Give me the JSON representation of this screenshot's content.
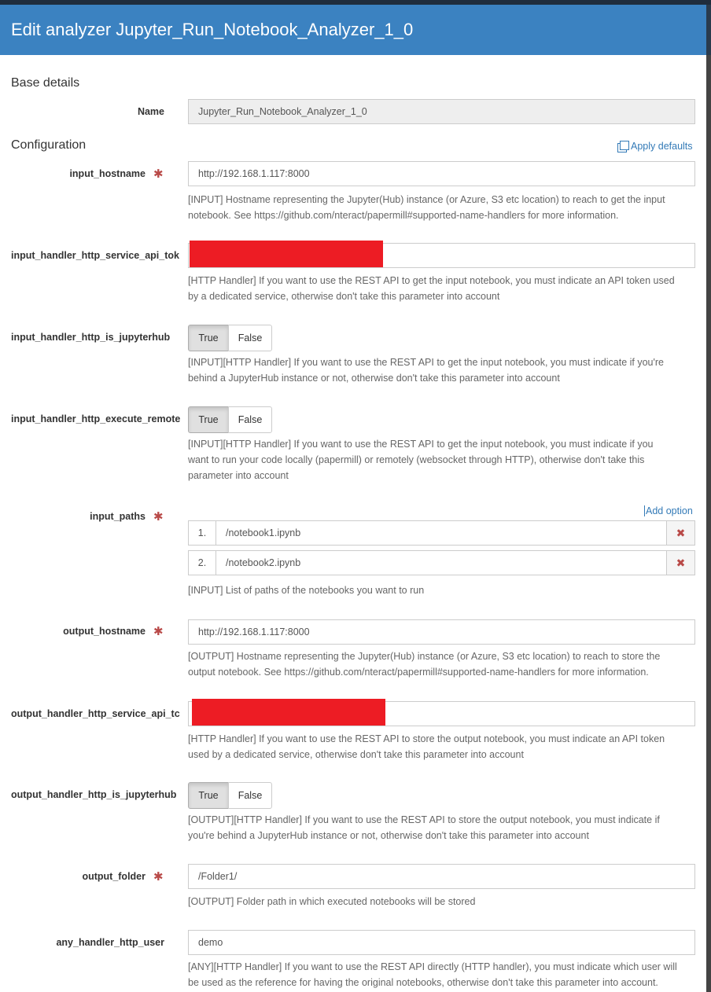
{
  "header": {
    "title": "Edit analyzer Jupyter_Run_Notebook_Analyzer_1_0"
  },
  "base": {
    "section_title": "Base details",
    "name_label": "Name",
    "name_value": "Jupyter_Run_Notebook_Analyzer_1_0"
  },
  "config": {
    "section_title": "Configuration",
    "apply_defaults": "Apply defaults",
    "fields": {
      "input_hostname": {
        "label": "input_hostname",
        "value": "http://192.168.1.117:8000",
        "help1": "[INPUT] Hostname representing the Jupyter(Hub) instance (or Azure, S3 etc location) to reach to get the input",
        "help2": "notebook. See https://github.com/nteract/papermill#supported-name-handlers for more information."
      },
      "input_api_token": {
        "label": "input_handler_http_service_api_tok",
        "help1": "[HTTP Handler] If you want to use the REST API to get the input notebook, you must indicate an API token used",
        "help2": "by a dedicated service, otherwise don't take this parameter into account"
      },
      "input_is_jupyterhub": {
        "label": "input_handler_http_is_jupyterhub",
        "true_label": "True",
        "false_label": "False",
        "help1": "[INPUT][HTTP Handler] If you want to use the REST API to get the input notebook, you must indicate if you're",
        "help2": "behind a JupyterHub instance or not, otherwise don't take this parameter into account"
      },
      "input_execute_remote": {
        "label": "input_handler_http_execute_remote",
        "true_label": "True",
        "false_label": "False",
        "help1": "[INPUT][HTTP Handler] If you want to use the REST API to get the input notebook, you must indicate if you",
        "help2": "want to run your code locally (papermill) or remotely (websocket through HTTP), otherwise don't take this",
        "help3": "parameter into account"
      },
      "input_paths": {
        "label": "input_paths",
        "add_option": "Add option",
        "items": [
          {
            "num": "1.",
            "value": "/notebook1.ipynb"
          },
          {
            "num": "2.",
            "value": "/notebook2.ipynb"
          }
        ],
        "help1": "[INPUT] List of paths of the notebooks you want to run"
      },
      "output_hostname": {
        "label": "output_hostname",
        "value": "http://192.168.1.117:8000",
        "help1": "[OUTPUT] Hostname representing the Jupyter(Hub) instance (or Azure, S3 etc location) to reach to store the",
        "help2": "output notebook. See https://github.com/nteract/papermill#supported-name-handlers for more information."
      },
      "output_api_token": {
        "label": "output_handler_http_service_api_tc",
        "help1": "[HTTP Handler] If you want to use the REST API to store the output notebook, you must indicate an API token",
        "help2": "used by a dedicated service, otherwise don't take this parameter into account"
      },
      "output_is_jupyterhub": {
        "label": "output_handler_http_is_jupyterhub",
        "true_label": "True",
        "false_label": "False",
        "help1": "[OUTPUT][HTTP Handler] If you want to use the REST API to store the output notebook, you must indicate if",
        "help2": "you're behind a JupyterHub instance or not, otherwise don't take this parameter into account"
      },
      "output_folder": {
        "label": "output_folder",
        "value": "/Folder1/",
        "help1": "[OUTPUT] Folder path in which executed notebooks will be stored"
      },
      "any_user": {
        "label": "any_handler_http_user",
        "value": "demo",
        "help1": "[ANY][HTTP Handler] If you want to use the REST API directly (HTTP handler), you must indicate which user will",
        "help2": "be used as the reference for having the original notebooks, otherwise don't take this parameter into account."
      }
    }
  },
  "colors": {
    "header": "#3b82c1",
    "required": "#b94a48",
    "redaction": "#ed1c24",
    "link": "#337ab7"
  }
}
